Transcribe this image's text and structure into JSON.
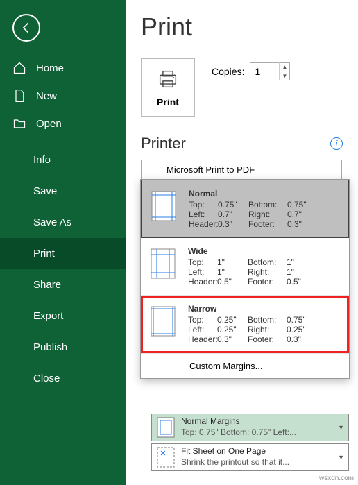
{
  "sidebar": {
    "items": [
      {
        "label": "Home"
      },
      {
        "label": "New"
      },
      {
        "label": "Open"
      }
    ],
    "sub": [
      "Info",
      "Save",
      "Save As",
      "Print",
      "Share",
      "Export",
      "Publish",
      "Close"
    ],
    "active": "Print"
  },
  "page": {
    "title": "Print"
  },
  "printCard": {
    "label": "Print"
  },
  "copies": {
    "label": "Copies:",
    "value": "1"
  },
  "printerSection": {
    "title": "Printer"
  },
  "printerSelector": {
    "name": "Microsoft Print to PDF"
  },
  "marginsDropdown": {
    "options": [
      {
        "name": "Normal",
        "rows": [
          [
            "Top:",
            "0.75\"",
            "Bottom:",
            "0.75\""
          ],
          [
            "Left:",
            "0.7\"",
            "Right:",
            "0.7\""
          ],
          [
            "Header:",
            "0.3\"",
            "Footer:",
            "0.3\""
          ]
        ],
        "selected": true
      },
      {
        "name": "Wide",
        "rows": [
          [
            "Top:",
            "1\"",
            "Bottom:",
            "1\""
          ],
          [
            "Left:",
            "1\"",
            "Right:",
            "1\""
          ],
          [
            "Header:",
            "0.5\"",
            "Footer:",
            "0.5\""
          ]
        ]
      },
      {
        "name": "Narrow",
        "rows": [
          [
            "Top:",
            "0.25\"",
            "Bottom:",
            "0.75\""
          ],
          [
            "Left:",
            "0.25\"",
            "Right:",
            "0.25\""
          ],
          [
            "Header:",
            "0.3\"",
            "Footer:",
            "0.3\""
          ]
        ],
        "highlight": true
      }
    ],
    "custom": "Custom Margins..."
  },
  "selectors": {
    "margins": {
      "title": "Normal Margins",
      "sub": "Top: 0.75\" Bottom: 0.75\" Left:..."
    },
    "scaling": {
      "title": "Fit Sheet on One Page",
      "sub": "Shrink the printout so that it..."
    }
  },
  "watermark": "wsxdn.com"
}
